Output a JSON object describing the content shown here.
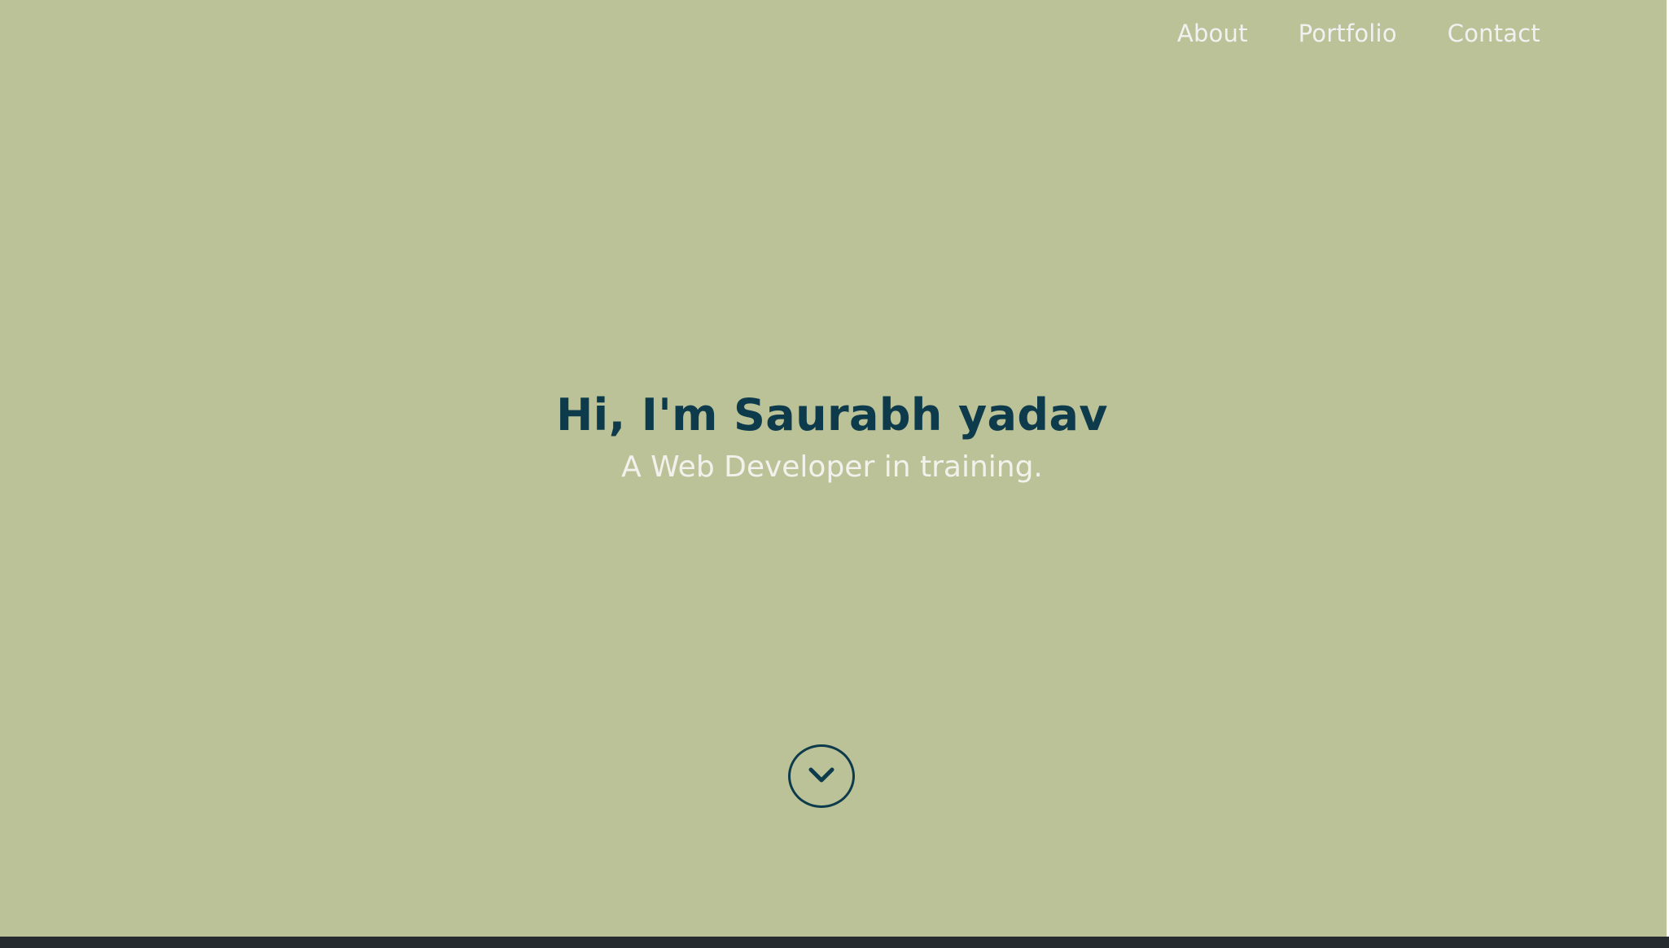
{
  "nav": {
    "items": [
      {
        "label": "About"
      },
      {
        "label": "Portfolio"
      },
      {
        "label": "Contact"
      }
    ]
  },
  "hero": {
    "title": "Hi, I'm Saurabh yadav",
    "subtitle": "A Web Developer in training."
  },
  "scroll_button": {
    "icon": "chevron-down-icon"
  },
  "colors": {
    "background": "#bcc298",
    "title": "#0d3b4c",
    "nav_text": "#f1f1f1",
    "subtitle": "#f2f1ec"
  }
}
